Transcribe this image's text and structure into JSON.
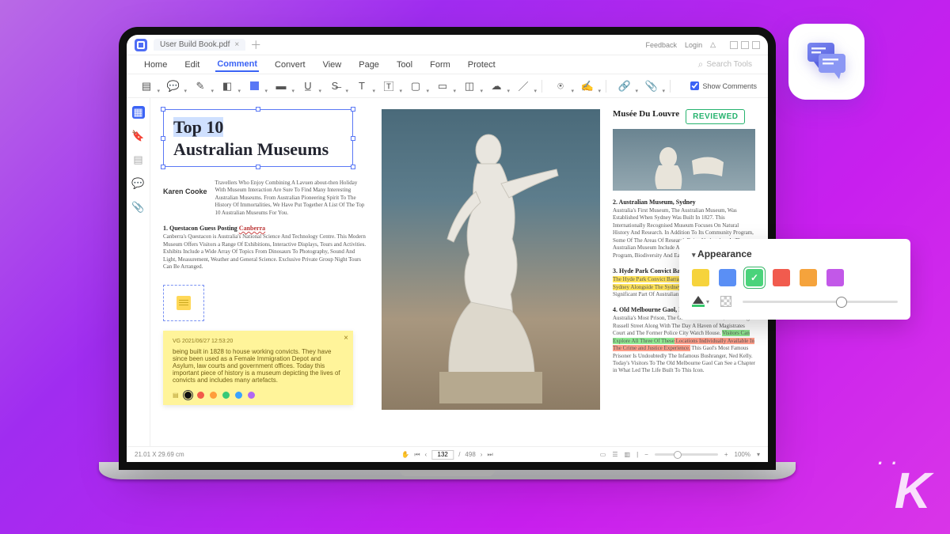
{
  "titlebar": {
    "filename": "User Build Book.pdf",
    "feedback": "Feedback",
    "login": "Login"
  },
  "menu": {
    "items": [
      "Home",
      "Edit",
      "Comment",
      "Convert",
      "View",
      "Page",
      "Tool",
      "Form",
      "Protect"
    ],
    "active_index": 2,
    "search_placeholder": "Search Tools"
  },
  "toolbar": {
    "icons": [
      "note",
      "comment",
      "pencil",
      "eraser",
      "shape",
      "highlighter",
      "underline",
      "strike",
      "text",
      "textbox",
      "area",
      "rect",
      "callout",
      "cloud",
      "line",
      "sep",
      "stamp",
      "signature",
      "sep",
      "link",
      "attach",
      "sep"
    ],
    "show_comments_label": "Show Comments",
    "show_comments_checked": true
  },
  "sidebar": {
    "icons": [
      "thumbnails",
      "bookmark",
      "layers",
      "comments",
      "attachments"
    ],
    "active_index": 0
  },
  "doc": {
    "title_l1": "Top 10",
    "title_l2": "Australian Museums",
    "author": "Karen Cooke",
    "lead": "Travellers Who Enjoy Combining A Lavuen about-then Holiday With Museum Interaction Are Sure To Find Many Interesting Australian Museums. From Australian Pioneering Spirit To The History Of Immortalities, We Have Put Together A List Of The Top 10 Australian Museums For You.",
    "sec1_title": "1. Questacon Guess Posting Canberra",
    "sec1_circled": "Canberra",
    "sec1_body": "Canberra's Questacon is Australia's National Science And Technology Centre. This Modern Museum Offers Visitors a Range Of Exhibitions, Interactive Displays, Tours and Activities. Exhibits Include a Wide Array Of Topics From Dinosaurs To Photography, Sound And Light, Measurement, Weather and General Science. Exclusive Private Group Night Tours Can Be Arranged.",
    "sticky": {
      "meta": "VG 2021/06/27 12:53:20",
      "body": "being built in 1828 to house working convicts. They have since been used as a Female Immigration Depot and Asylum, law courts and government offices. Today this important piece of history is a museum depicting the lives of convicts and includes many artefacts.",
      "colors": [
        "#111",
        "#f25b4a",
        "#ff9d3b",
        "#37c977",
        "#3aa3ff",
        "#b268f2"
      ],
      "selected_color_index": 0
    },
    "r1_title": "Musée Du Louvre",
    "r1_badge": "REVIEWED",
    "sec2_title": "2. Australian Museum, Sydney",
    "sec2_body": "Australia's First Museum, The Australian Museum, Was Established When Sydney Was Built In 1827. This Internationally Recognised Museum Focuses On Natural History And Research. In Addition To Its Community Program, Some Of The Areas Of Research Being Undertaken At The Australian Museum Include Anthropology Collections Program, Biodiversity And Earth Environs.",
    "sec3_title": "3. Hyde Park Convict Barracks, Sydney",
    "sec3_hl": "The Hyde Park Convict Barracks Are In Macquarie Street Sydney Alongside The Sydney Mint.",
    "sec3_rest": " These Barracks Are A Significant Part Of Australian History.",
    "sec4_title": "4. Old Melbourne Gaol, Melbourne",
    "sec4_body_a": "Australia's Most Prison, The Old Melbourne Gaol, Sits Along Russell Street Along With The Day A Haven of Magistrates Court and The Former Police City Watch House. ",
    "sec4_hl_g": "Visitors Can Explore All Three Of These",
    "sec4_hl_r": " Locations Individually Available In The Crime and Justice Experience.",
    "sec4_rest": " This Gaol's Most Famous Prisoner Is Undoubtedly The Infamous Bushranger, Ned Kelly. Today's Visitors To The Old Melbourne Gaol Can See a Chapter in What Led The Life Built To This Icon."
  },
  "status": {
    "dims": "21.01 X 29.69 cm",
    "page_current": "132",
    "page_total": "498",
    "zoom": "100%"
  },
  "appearance": {
    "title": "Appearance",
    "colors": [
      {
        "hex": "#f6d33c",
        "selected": false
      },
      {
        "hex": "#5a8ff5",
        "selected": false
      },
      {
        "hex": "#4bd37b",
        "selected": true
      },
      {
        "hex": "#f15b4e",
        "selected": false
      },
      {
        "hex": "#f5a33c",
        "selected": false
      },
      {
        "hex": "#c258e8",
        "selected": false
      }
    ]
  }
}
